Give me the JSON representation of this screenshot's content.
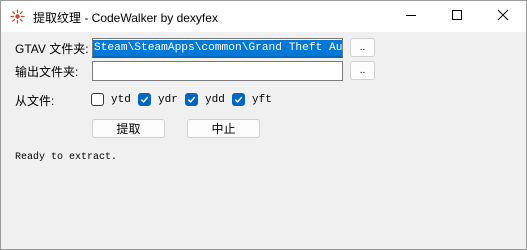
{
  "window": {
    "title": "提取纹理 - CodeWalker by dexyfex",
    "icon": "codewalker-app-icon",
    "controls": {
      "minimize": "minimize-icon",
      "maximize": "maximize-icon",
      "close": "close-icon"
    }
  },
  "form": {
    "gtav_label": "GTAV 文件夹:",
    "gtav_value": "Steam\\SteamApps\\common\\Grand Theft Auto V",
    "output_label": "输出文件夹:",
    "output_value": "",
    "browse_label": "..",
    "from_files_label": "从文件:",
    "file_types": [
      {
        "label": "ytd",
        "checked": false
      },
      {
        "label": "ydr",
        "checked": true
      },
      {
        "label": "ydd",
        "checked": true
      },
      {
        "label": "yft",
        "checked": true
      }
    ],
    "extract_button": "提取",
    "stop_button": "中止"
  },
  "status_text": "Ready to extract.",
  "colors": {
    "accent": "#0067c0",
    "selection": "#0078d7"
  }
}
